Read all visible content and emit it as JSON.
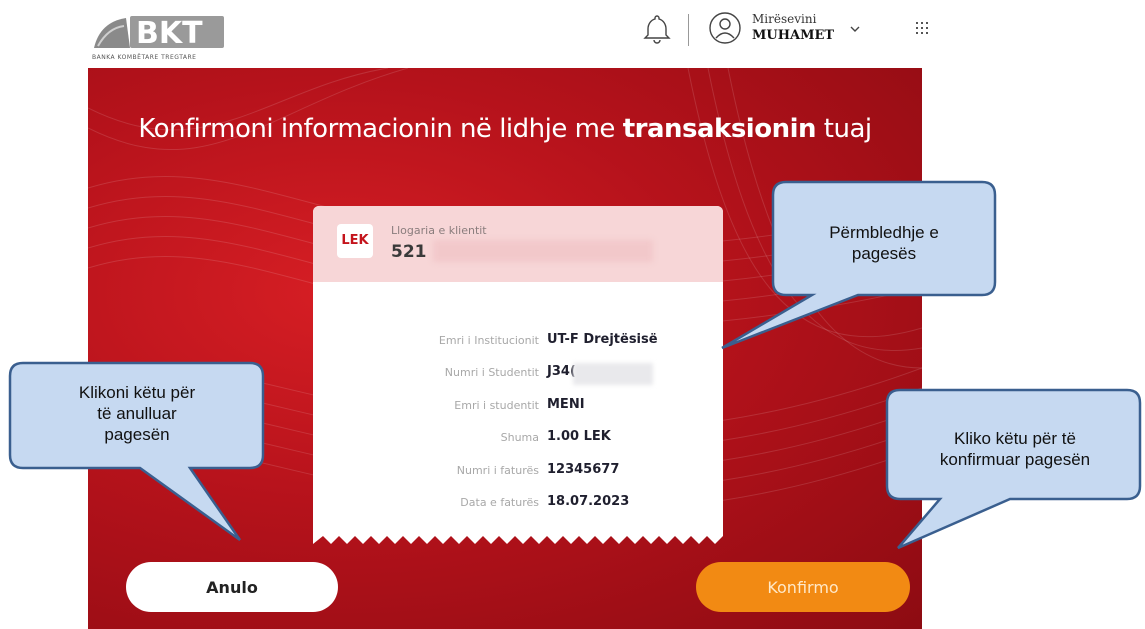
{
  "header": {
    "logo_text": "BKT",
    "logo_subtitle": "BANKA KOMBËTARE TREGTARE",
    "greeting": "Mirësevini",
    "user_name": "MUHAMET"
  },
  "main": {
    "heading_pre": "Konfirmoni informacionin në lidhje me ",
    "heading_bold": "transaksionin",
    "heading_post": " tuaj"
  },
  "card": {
    "currency": "LEK",
    "account_label": "Llogaria e klientit",
    "account_number": "521",
    "rows": [
      {
        "label": "Emri i Institucionit",
        "value": "UT-F Drejtësisë"
      },
      {
        "label": "Numri i Studentit",
        "value": "J34("
      },
      {
        "label": "Emri i studentit",
        "value": "MENI"
      },
      {
        "label": "Shuma",
        "value": "1.00 LEK"
      },
      {
        "label": "Numri i faturës",
        "value": "12345677"
      },
      {
        "label": "Data e faturës",
        "value": "18.07.2023"
      }
    ]
  },
  "buttons": {
    "cancel": "Anulo",
    "confirm": "Konfirmo"
  },
  "callouts": {
    "summary": [
      "Përmbledhje e",
      "pagesës"
    ],
    "cancel_hint": [
      "Klikoni këtu për",
      "të anulluar",
      "pagesën"
    ],
    "confirm_hint": [
      "Kliko këtu për të",
      "konfirmuar pagesën"
    ]
  },
  "colors": {
    "brand_red": "#c4141c",
    "confirm_orange": "#f28a13",
    "callout_fill": "#c6d9f1",
    "callout_stroke": "#3a5f8f"
  }
}
